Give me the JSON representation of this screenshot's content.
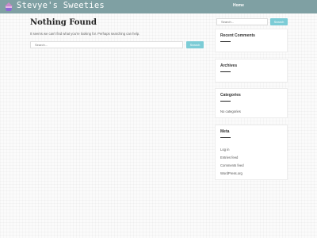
{
  "header": {
    "site_title": "Stevye's Sweeties",
    "nav": {
      "home_label": "Home"
    },
    "colors": {
      "bar": "#7fa0a3",
      "logo": "#c989c9"
    },
    "logo_icon": "cupcake-icon"
  },
  "main": {
    "title": "Nothing Found",
    "message": "It seems we can't find what you're looking for. Perhaps searching can help.",
    "search": {
      "placeholder": "Search...",
      "button_label": "Search"
    }
  },
  "sidebar": {
    "search": {
      "placeholder": "Search...",
      "button_label": "Search"
    },
    "recent_comments": {
      "title": "Recent Comments"
    },
    "archives": {
      "title": "Archives"
    },
    "categories": {
      "title": "Categories",
      "empty_text": "No categories"
    },
    "meta": {
      "title": "Meta",
      "links": [
        "Log in",
        "Entries feed",
        "Comments feed",
        "WordPress.org"
      ]
    }
  },
  "colors": {
    "accent_button": "#7cccd6"
  }
}
